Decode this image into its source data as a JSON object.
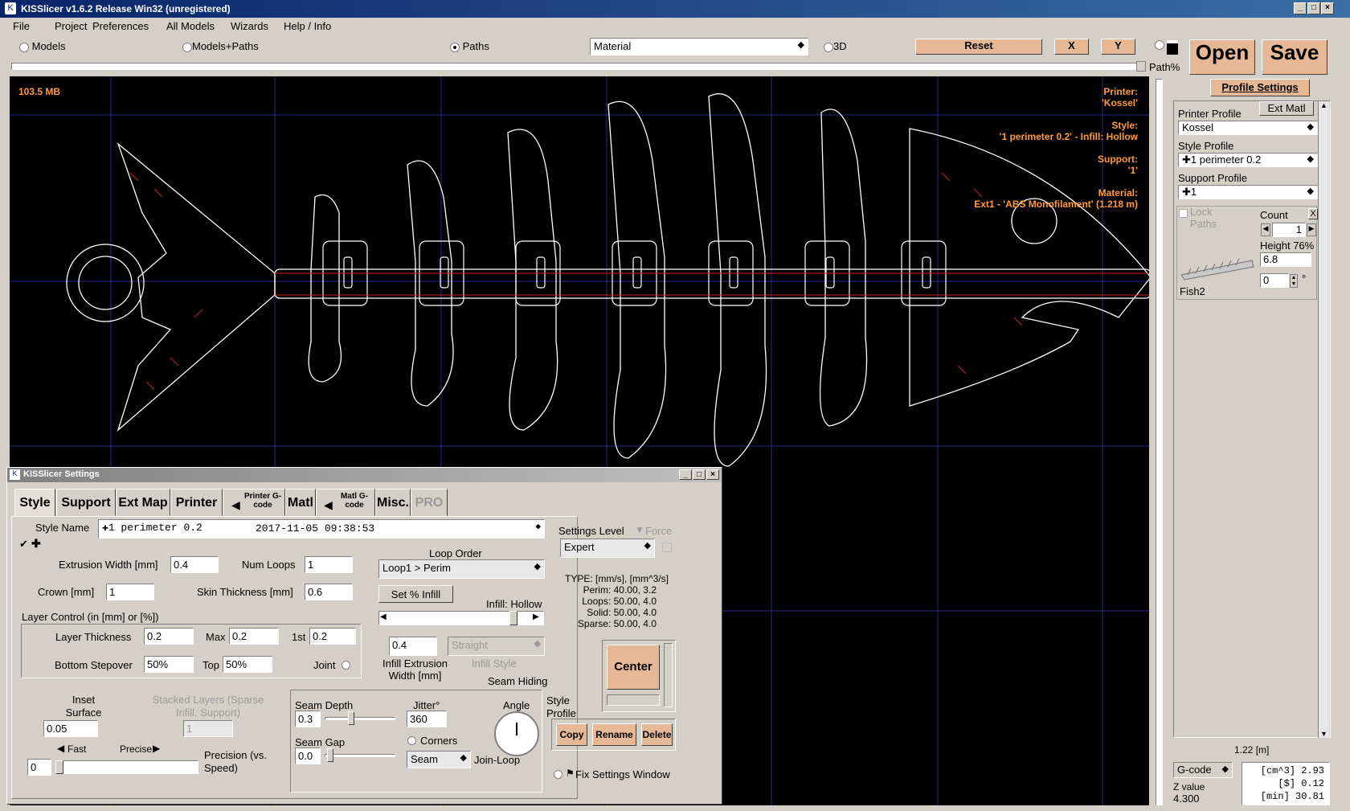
{
  "window": {
    "title": "KISSlicer v1.6.2 Release Win32 (unregistered)"
  },
  "menu": [
    "File",
    "Project",
    "Preferences",
    "All Models",
    "Wizards",
    "Help / Info"
  ],
  "toolbar": {
    "radio_models": "Models",
    "radio_models_paths": "Models+Paths",
    "radio_paths": "Paths",
    "color_mode": "Material",
    "radio_3d": "3D",
    "reset": "Reset",
    "x": "X",
    "y": "Y",
    "path_pct": "Path%",
    "open": "Open",
    "save": "Save"
  },
  "viewport": {
    "memory": "103.5 MB",
    "printer_label": "Printer:",
    "printer_value": "'Kossel'",
    "style_label": "Style:",
    "style_value": "'1 perimeter 0.2' - Infill: Hollow",
    "support_label": "Support:",
    "support_value": "'1'",
    "material_label": "Material:",
    "material_value": "Ext1 - 'ABS Monofilament' (1.218 m)"
  },
  "right_panel": {
    "profile_settings": "Profile Settings",
    "ext_matl": "Ext Matl",
    "printer_profile_label": "Printer Profile",
    "printer_profile": "Kossel",
    "style_profile_label": "Style Profile",
    "style_profile": "1 perimeter 0.2",
    "support_profile_label": "Support Profile",
    "support_profile": "1",
    "lock_paths": "Lock Paths",
    "count_label": "Count",
    "count_value": "1",
    "close_x": "X",
    "height_label": "Height 76%",
    "height_value": "6.8",
    "angle_value": "0",
    "degree": "°",
    "model_name": "Fish2",
    "length": "1.22 [m]",
    "gcode_label": "G-code",
    "z_value_label": "Z value",
    "z_value": "4.300",
    "stats": [
      "[cm^3] 2.93",
      "[$] 0.12",
      "[min] 30.81"
    ]
  },
  "settings": {
    "title": "KISSlicer Settings",
    "tabs": [
      "Style",
      "Support",
      "Ext Map",
      "Printer",
      "Printer G-code",
      "Matl",
      "Matl G-code",
      "Misc.",
      "PRO"
    ],
    "style_name_label": "Style Name",
    "style_name": "1 perimeter 0.2",
    "style_date": "2017-11-05 09:38:53",
    "extrusion_width_label": "Extrusion Width [mm]",
    "extrusion_width": "0.4",
    "num_loops_label": "Num Loops",
    "num_loops": "1",
    "crown_label": "Crown [mm]",
    "crown": "1",
    "skin_thickness_label": "Skin Thickness [mm]",
    "skin_thickness": "0.6",
    "loop_order_label": "Loop Order",
    "loop_order": "Loop1 > Perim",
    "set_infill": "Set % Infill",
    "infill_label": "Infill: Hollow",
    "layer_control_label": "Layer Control (in [mm] or [%])",
    "layer_thickness_label": "Layer Thickness",
    "layer_thickness": "0.2",
    "max_label": "Max",
    "max": "0.2",
    "first_label": "1st",
    "first": "0.2",
    "bottom_stepover_label": "Bottom Stepover",
    "bottom_stepover": "50%",
    "top_label": "Top",
    "top": "50%",
    "joint_label": "Joint",
    "infill_ext_width": "0.4",
    "infill_ext_width_label": "Infill Extrusion Width [mm]",
    "infill_style": "Straight",
    "infill_style_label": "Infill Style",
    "seam_hiding_label": "Seam Hiding",
    "inset_surface_label": "Inset Surface [mm]",
    "inset_surface": "0.05",
    "stacked_layers_label": "Stacked Layers (Sparse Infill, Support)",
    "stacked_layers": "1",
    "fast_label": "Fast",
    "precise_label": "Precise",
    "precision_value": "0",
    "precision_label": "Precision (vs. Speed)",
    "seam_depth_label": "Seam Depth",
    "seam_depth": "0.3",
    "jitter_label": "Jitter°",
    "jitter": "360",
    "angle_label": "Angle",
    "seam_gap_label": "Seam Gap",
    "seam_gap": "0.0",
    "corners_label": "Corners",
    "seam_mode": "Seam",
    "join_loop_label": "Join-Loop",
    "settings_level_label": "Settings Level",
    "force_label": "Force",
    "settings_level": "Expert",
    "speed_header": "TYPE: [mm/s], [mm^3/s]",
    "speeds": [
      "Perim:  40.00,  3.2",
      "Loops:  50.00,  4.0",
      "Solid:  50.00,  4.0",
      "Sparse:  50.00,  4.0"
    ],
    "center": "Center",
    "style_profile_label": "Style Profile",
    "copy": "Copy",
    "rename": "Rename",
    "delete": "Delete",
    "fix_window": "Fix Settings Window"
  }
}
